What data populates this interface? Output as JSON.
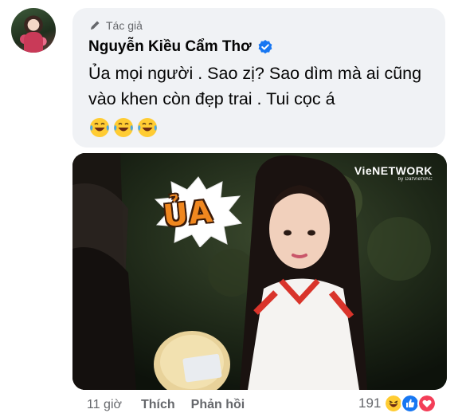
{
  "author_tag": {
    "label": "Tác giả",
    "icon": "pen-icon"
  },
  "author": {
    "name": "Nguyễn Kiều Cẩm Thơ",
    "verified_icon": "verified-badge-icon"
  },
  "comment": {
    "text": "Ủa mọi người . Sao zị? Sao dìm mà ai cũng vào khen còn đẹp trai . Tui cọc á",
    "emojis": [
      "laughing-tears-emoji",
      "laughing-tears-emoji",
      "laughing-tears-emoji"
    ]
  },
  "media": {
    "watermark": {
      "main": "VieNETWORK",
      "sub": "by DatVietVAC"
    },
    "sticker_text": "ỦA"
  },
  "actions": {
    "time": "11 giờ",
    "like": "Thích",
    "reply": "Phản hồi"
  },
  "reactions": {
    "count": "191",
    "icons": [
      "haha-icon",
      "like-icon",
      "love-icon"
    ]
  },
  "colors": {
    "bubble_bg": "#f0f2f5",
    "secondary_text": "#65676b",
    "verified_blue": "#1877f2"
  }
}
